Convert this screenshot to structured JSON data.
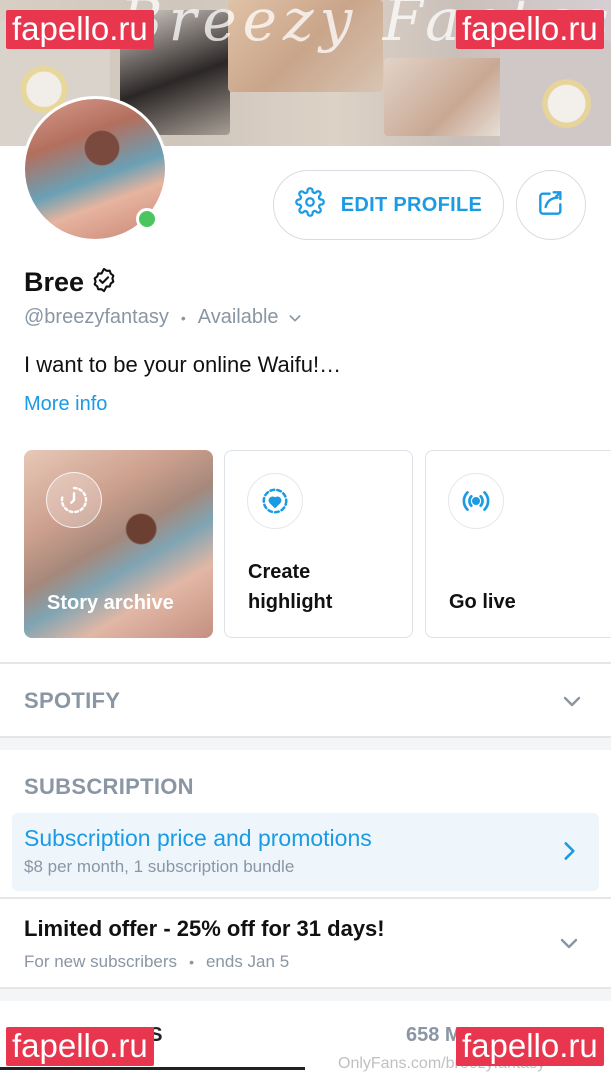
{
  "watermark": {
    "text": "fapello.ru",
    "color": "#e8364f"
  },
  "cover": {
    "script_text": "Breezy Fantasy"
  },
  "profile": {
    "name": "Bree",
    "handle": "@breezyfantasy",
    "status": "Available",
    "bio": "I want to be your online Waifu!…",
    "more_info": "More info",
    "online": true
  },
  "actions": {
    "edit_profile": "EDIT PROFILE"
  },
  "stories": [
    {
      "label": "Story archive",
      "icon": "story-archive-icon"
    },
    {
      "label": "Create highlight",
      "icon": "highlight-icon"
    },
    {
      "label": "Go live",
      "icon": "live-icon"
    }
  ],
  "sections": {
    "spotify": "SPOTIFY",
    "subscription": "SUBSCRIPTION"
  },
  "subscription": {
    "title": "Subscription price and promotions",
    "subtitle": "$8 per month, 1 subscription bundle"
  },
  "offer": {
    "title": "Limited offer - 25% off for 31 days!",
    "audience": "For new subscribers",
    "ends": "ends Jan 5"
  },
  "tabs": {
    "posts": "OSTS",
    "media": "658 M"
  },
  "footer_watermark": "OnlyFans.com/breezyfantasy",
  "colors": {
    "accent": "#1a9be3",
    "muted": "#8a96a3",
    "online": "#4cc55f"
  }
}
